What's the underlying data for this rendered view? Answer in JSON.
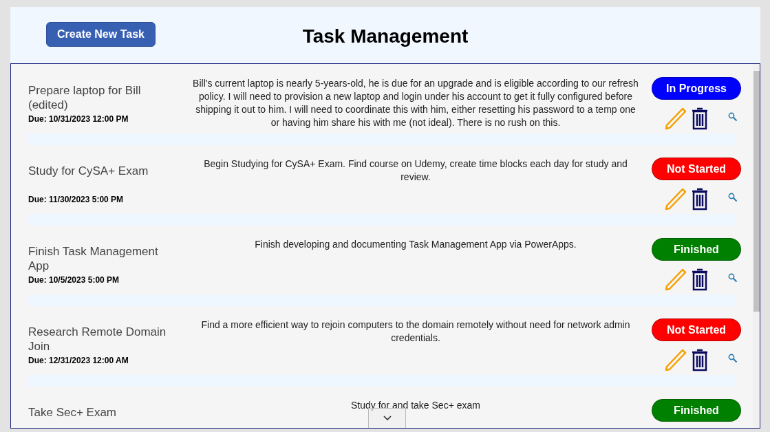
{
  "header": {
    "create_button": "Create New Task",
    "title": "Task Management"
  },
  "tasks": [
    {
      "title": "Prepare laptop for Bill (edited)",
      "due": "Due: 10/31/2023 12:00 PM",
      "description": "Bill's current laptop is nearly 5-years-old, he is due for an upgrade and is eligible according to our refresh policy. I will need to provision a new laptop and login under his account to get it fully configured before shipping it out to him. I will need to coordinate this with him, either resetting his password to a temp one or having him share his with me (not ideal). There is no rush on this.",
      "status": "In Progress",
      "color": "#0000ff"
    },
    {
      "title": "Study for CySA+ Exam",
      "due": "Due: 11/30/2023 5:00 PM",
      "description": "Begin Studying for CySA+ Exam. Find course on Udemy, create time blocks each day for study and review.",
      "status": "Not Started",
      "color": "#ff0000"
    },
    {
      "title": "Finish Task Management App",
      "due": "Due: 10/5/2023 5:00 PM",
      "description": "Finish developing and documenting Task Management App via PowerApps.",
      "status": "Finished",
      "color": "#008000"
    },
    {
      "title": "Research Remote Domain Join",
      "due": "Due: 12/31/2023 12:00 AM",
      "description": "Find a more efficient way to rejoin computers to the domain remotely without need for network admin credentials.",
      "status": "Not Started",
      "color": "#ff0000"
    },
    {
      "title": "Take Sec+ Exam",
      "description": "Study for and take Sec+ exam",
      "status": "Finished",
      "color": "#008000"
    }
  ]
}
